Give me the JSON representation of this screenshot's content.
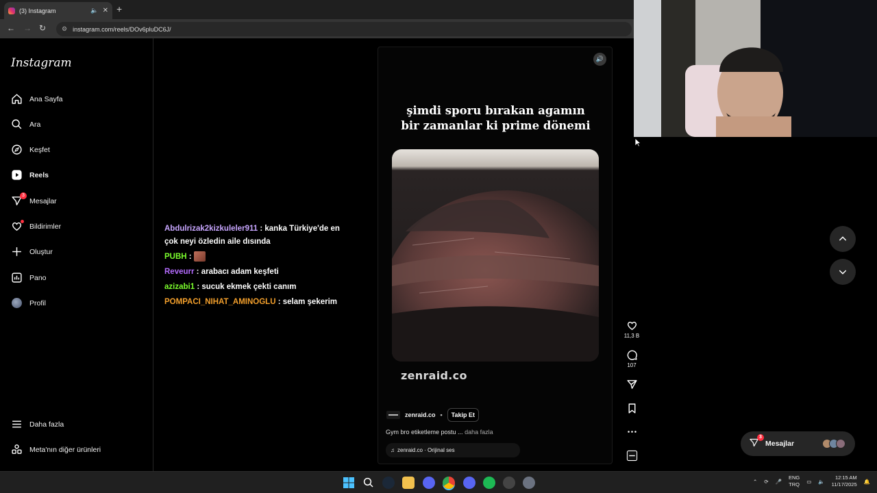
{
  "browser": {
    "tab_title": "(3) Instagram",
    "url": "instagram.com/reels/DOv6pluDC6J/",
    "new_tab_label": "+"
  },
  "sidebar": {
    "logo": "Instagram",
    "items": [
      {
        "label": "Ana Sayfa",
        "icon": "home-icon"
      },
      {
        "label": "Ara",
        "icon": "search-icon"
      },
      {
        "label": "Keşfet",
        "icon": "compass-icon"
      },
      {
        "label": "Reels",
        "icon": "reels-icon",
        "active": true
      },
      {
        "label": "Mesajlar",
        "icon": "messenger-icon",
        "badge": "3"
      },
      {
        "label": "Bildirimler",
        "icon": "heart-icon"
      },
      {
        "label": "Oluştur",
        "icon": "plus-icon"
      },
      {
        "label": "Pano",
        "icon": "dashboard-icon"
      },
      {
        "label": "Profil",
        "icon": "avatar"
      }
    ],
    "more": "Daha fazla",
    "meta": "Meta'nın diğer ürünleri"
  },
  "chat": [
    {
      "user": "Abdulrizak2kizkuleler911",
      "color": "#c8a6ff",
      "text": ": kanka Türkiye'de en çok neyi özledin aile dısında"
    },
    {
      "user": "PUBH",
      "color": "#7cff2d",
      "text": ":",
      "emote": true
    },
    {
      "user": "Reveurr",
      "color": "#b56cff",
      "text": ": arabacı adam keşfeti"
    },
    {
      "user": "azizabi1",
      "color": "#7cff2d",
      "text": ": sucuk ekmek çekti canım"
    },
    {
      "user": "POMPACI_NIHAT_AMINOGLU",
      "color": "#f4a02c",
      "text": ": selam şekerim"
    }
  ],
  "reel": {
    "overlay_line1": "şimdi sporu bırakan agamın",
    "overlay_line2": "bir zamanlar ki prime dönemi",
    "watermark": "zenraid.co",
    "author": "zenraid.co",
    "follow": "Takip Et",
    "description": "Gym bro etiketleme postu ...",
    "more": "daha fazla",
    "audio": "zenraid.co · Orijinal ses",
    "likes": "11,3 B",
    "comments": "107"
  },
  "floating": {
    "messages_label": "Mesajlar",
    "messages_badge": "3"
  },
  "tray": {
    "lang1": "ENG",
    "lang2": "TRQ",
    "time": "12:15 AM",
    "date": "11/17/2025"
  },
  "colors": {
    "accent_badge": "#ff3040",
    "background": "#000000"
  }
}
